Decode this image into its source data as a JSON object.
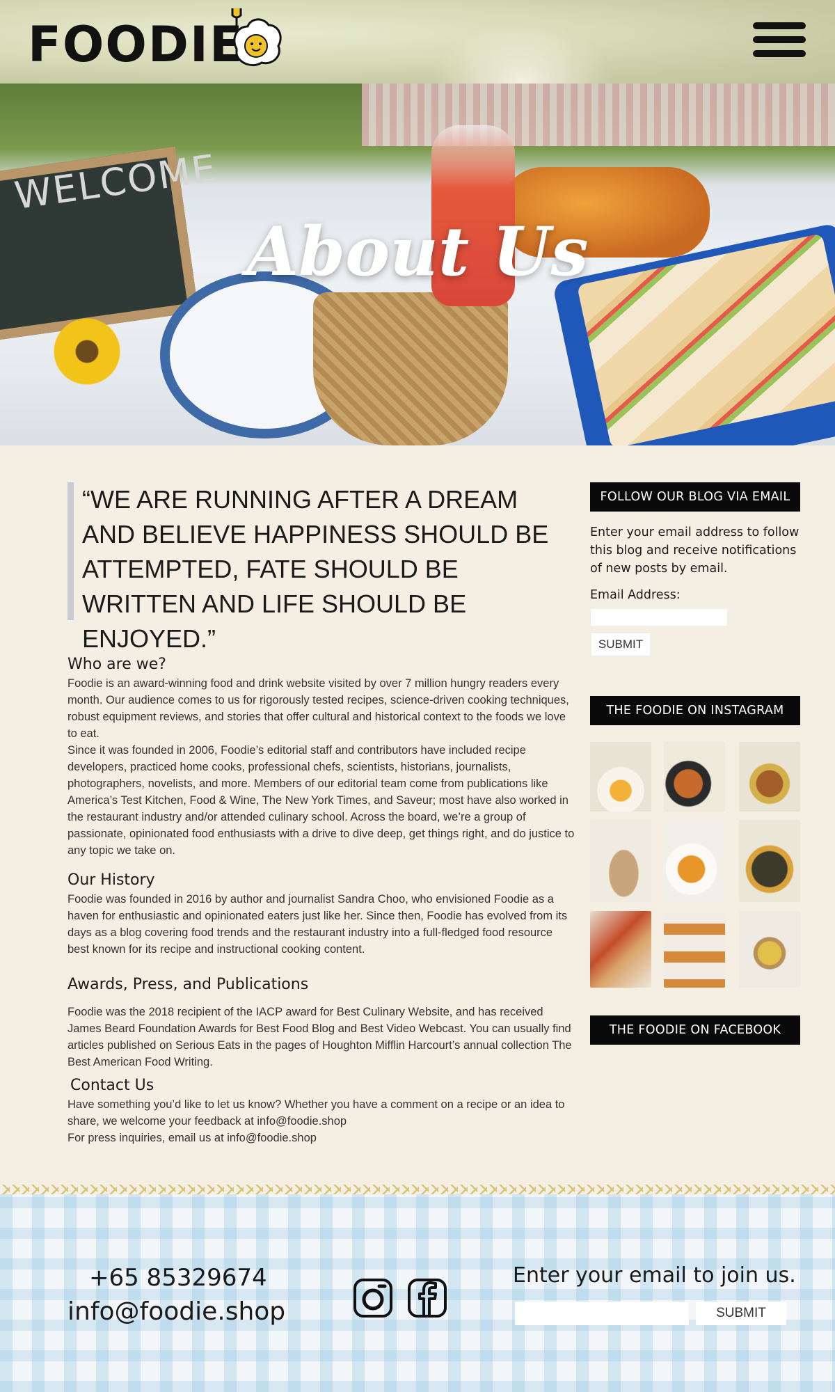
{
  "header": {
    "logo": "FOODIE",
    "logo_icon": "egg-icon",
    "menu_icon": "hamburger-menu-icon"
  },
  "hero": {
    "title": "About Us",
    "board_text": "WELCOME"
  },
  "quote": "“WE ARE RUNNING AFTER A DREAM AND BELIEVE HAPPINESS SHOULD BE ATTEMPTED, FATE SHOULD BE WRITTEN AND LIFE SHOULD BE ENJOYED.”",
  "sections": {
    "who": {
      "heading": "Who are we?",
      "p1": "Foodie is an award-winning food and drink website visited by over 7 million hungry readers every month. Our audience comes to us for rigorously tested recipes, science-driven cooking techniques, robust equipment reviews, and stories that offer cultural and historical context to the foods we love to eat.",
      "p2": "Since it was founded in 2006, Foodie’s editorial staff and contributors have included recipe developers, practiced home cooks, professional chefs, scientists, historians, journalists, photographers, novelists, and more. Members of our editorial team come from publications like America’s Test Kitchen, Food & Wine, The New York Times, and Saveur; most have also worked in the restaurant industry and/or attended culinary school. Across the board, we’re a group of passionate, opinionated food enthusiasts with a drive to dive deep, get things right, and do justice to any topic we take on."
    },
    "history": {
      "heading": "Our History",
      "p1": "Foodie was founded in 2016 by author and journalist Sandra Choo, who envisioned Foodie as a haven for enthusiastic and opinionated eaters just like her. Since then, Foodie has evolved from its days as a blog covering food trends and the restaurant industry into a full-fledged food resource best known for its recipe and instructional cooking content."
    },
    "awards": {
      "heading": "Awards, Press, and Publications",
      "p1": "Foodie was the 2018 recipient of the IACP award for Best Culinary Website, and has received James Beard Foundation Awards for Best Food Blog and Best Video Webcast. You can usually find articles published on Serious Eats in the pages of Houghton Mifflin Harcourt’s annual collection The Best American Food Writing."
    },
    "contact": {
      "heading": "Contact Us",
      "p1": "Have something you’d like to let us know? Whether you have a comment on a recipe or an idea to share, we welcome your feedback at info@foodie.shop",
      "p2": "For press inquiries, email us at info@foodie.shop"
    }
  },
  "sidebar": {
    "follow_title": "FOLLOW OUR BLOG VIA EMAIL",
    "follow_text": "Enter your email address to follow this blog and receive notifications of new posts by email.",
    "email_label": "Email Address:",
    "email_value": "",
    "submit_label": "SUBMIT",
    "instagram_title": "THE FOODIE ON INSTAGRAM",
    "facebook_title": "THE FOODIE ON FACEBOOK"
  },
  "footer": {
    "phone": "+65 85329674",
    "email": "info@foodie.shop",
    "instagram_icon": "instagram-icon",
    "facebook_icon": "facebook-icon",
    "join_text": "Enter your email to join us.",
    "join_input_value": "",
    "submit_label": "SUBMIT"
  }
}
